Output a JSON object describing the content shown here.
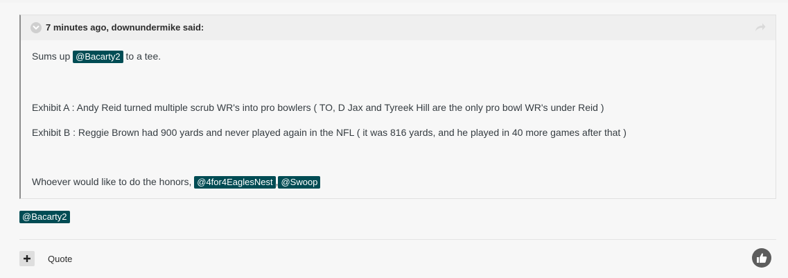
{
  "quote": {
    "citation": "7 minutes ago, downundermike said:",
    "lines": {
      "l1": {
        "pre": "Sums up ",
        "mention": "@Bacarty2",
        "post": " to a tee."
      },
      "l2": "Exhibit A : Andy Reid turned multiple scrub WR's into pro bowlers ( TO, D Jax and Tyreek Hill are the only pro bowl WR's under Reid )",
      "l3": "Exhibit B : Reggie Brown had 900 yards and never played again in the NFL ( it was 816 yards, and he played in 40 more games after that )",
      "l4": {
        "pre": "Whoever would like to do the honors, ",
        "mention1": "@4for4EaglesNest",
        "sep": ", ",
        "mention2": "@Swoop"
      }
    }
  },
  "reply": {
    "mention": "@Bacarty2"
  },
  "actions": {
    "quote_label": "Quote"
  },
  "colors": {
    "mention_bg": "#004c54",
    "mention_text": "#ffffff"
  },
  "icons": {
    "collapse": "chevron-down-circle-icon",
    "share": "share-arrow-icon",
    "multiquote": "plus-icon",
    "like": "thumbs-up-icon"
  }
}
